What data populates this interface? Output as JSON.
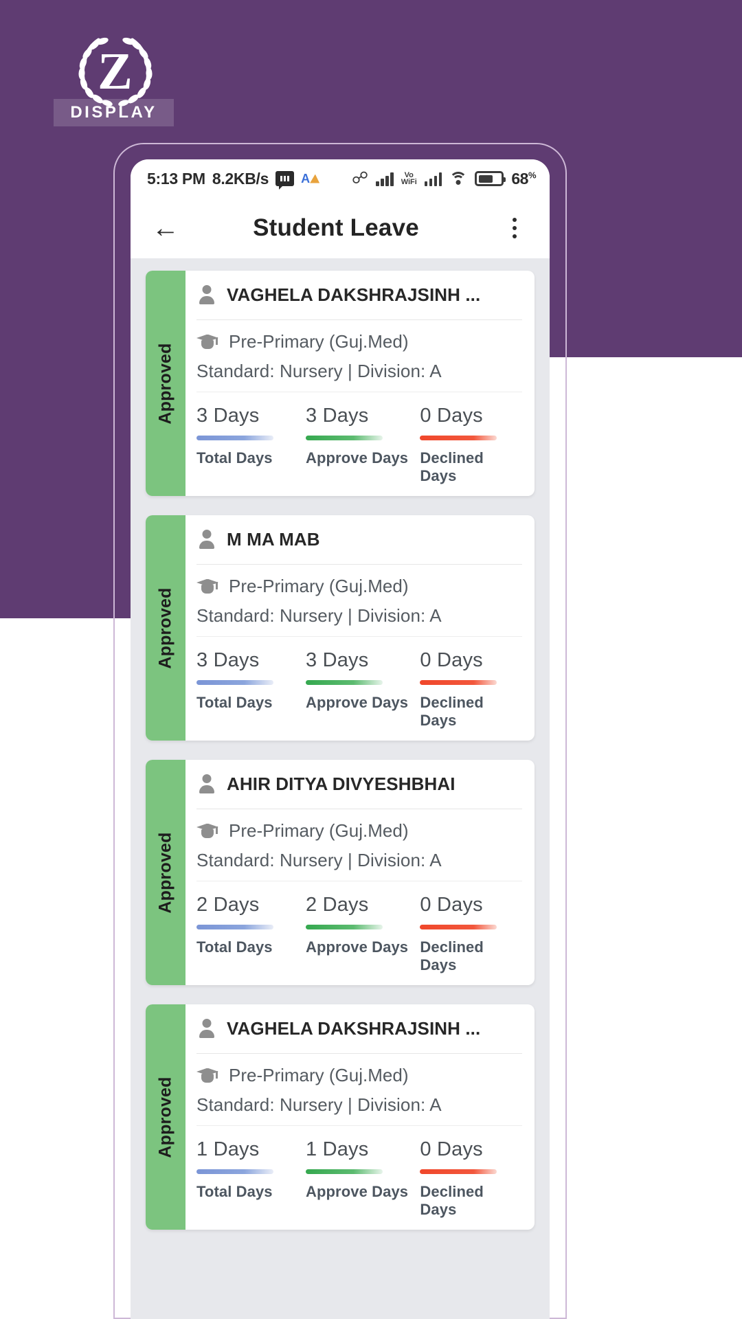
{
  "branding": {
    "logo_letter": "Z",
    "logo_word": "DISPLAY",
    "background_color": "#5f3c72"
  },
  "statusbar": {
    "time": "5:13 PM",
    "network_speed": "8.2KB/s",
    "icons_left": [
      "sms-icon",
      "translate-icon"
    ],
    "icons_right": [
      "bluetooth-icon",
      "signal-bars-icon",
      "volte-icon",
      "signal-bars-2-icon",
      "wifi-icon",
      "battery-icon"
    ],
    "volte_line1": "Vo",
    "volte_line2": "WiFi",
    "battery_percent": "68",
    "battery_percent_symbol": "%"
  },
  "appbar": {
    "back_icon": "back-arrow-icon",
    "title": "Student Leave",
    "menu_icon": "overflow-menu-icon"
  },
  "stat_labels": {
    "total": "Total Days",
    "approve": "Approve Days",
    "declined": "Declined Days"
  },
  "colors": {
    "approved_green": "#7cc47f",
    "total_bar": "#7b95d6",
    "approve_bar": "#35a84f",
    "declined_bar": "#f0472b"
  },
  "cards": [
    {
      "status": "Approved",
      "name": "VAGHELA DAKSHRAJSINH ...",
      "course": "Pre-Primary (Guj.Med)",
      "standard": "Standard: Nursery | Division: A",
      "total_days": "3 Days",
      "approve_days": "3 Days",
      "declined_days": "0 Days"
    },
    {
      "status": "Approved",
      "name": "M MA MAB",
      "course": "Pre-Primary (Guj.Med)",
      "standard": "Standard: Nursery | Division: A",
      "total_days": "3 Days",
      "approve_days": "3 Days",
      "declined_days": "0 Days"
    },
    {
      "status": "Approved",
      "name": "AHIR DITYA DIVYESHBHAI",
      "course": "Pre-Primary (Guj.Med)",
      "standard": "Standard: Nursery | Division: A",
      "total_days": "2 Days",
      "approve_days": "2 Days",
      "declined_days": "0 Days"
    },
    {
      "status": "Approved",
      "name": "VAGHELA DAKSHRAJSINH ...",
      "course": "Pre-Primary (Guj.Med)",
      "standard": "Standard: Nursery | Division: A",
      "total_days": "1 Days",
      "approve_days": "1 Days",
      "declined_days": "0 Days"
    }
  ]
}
